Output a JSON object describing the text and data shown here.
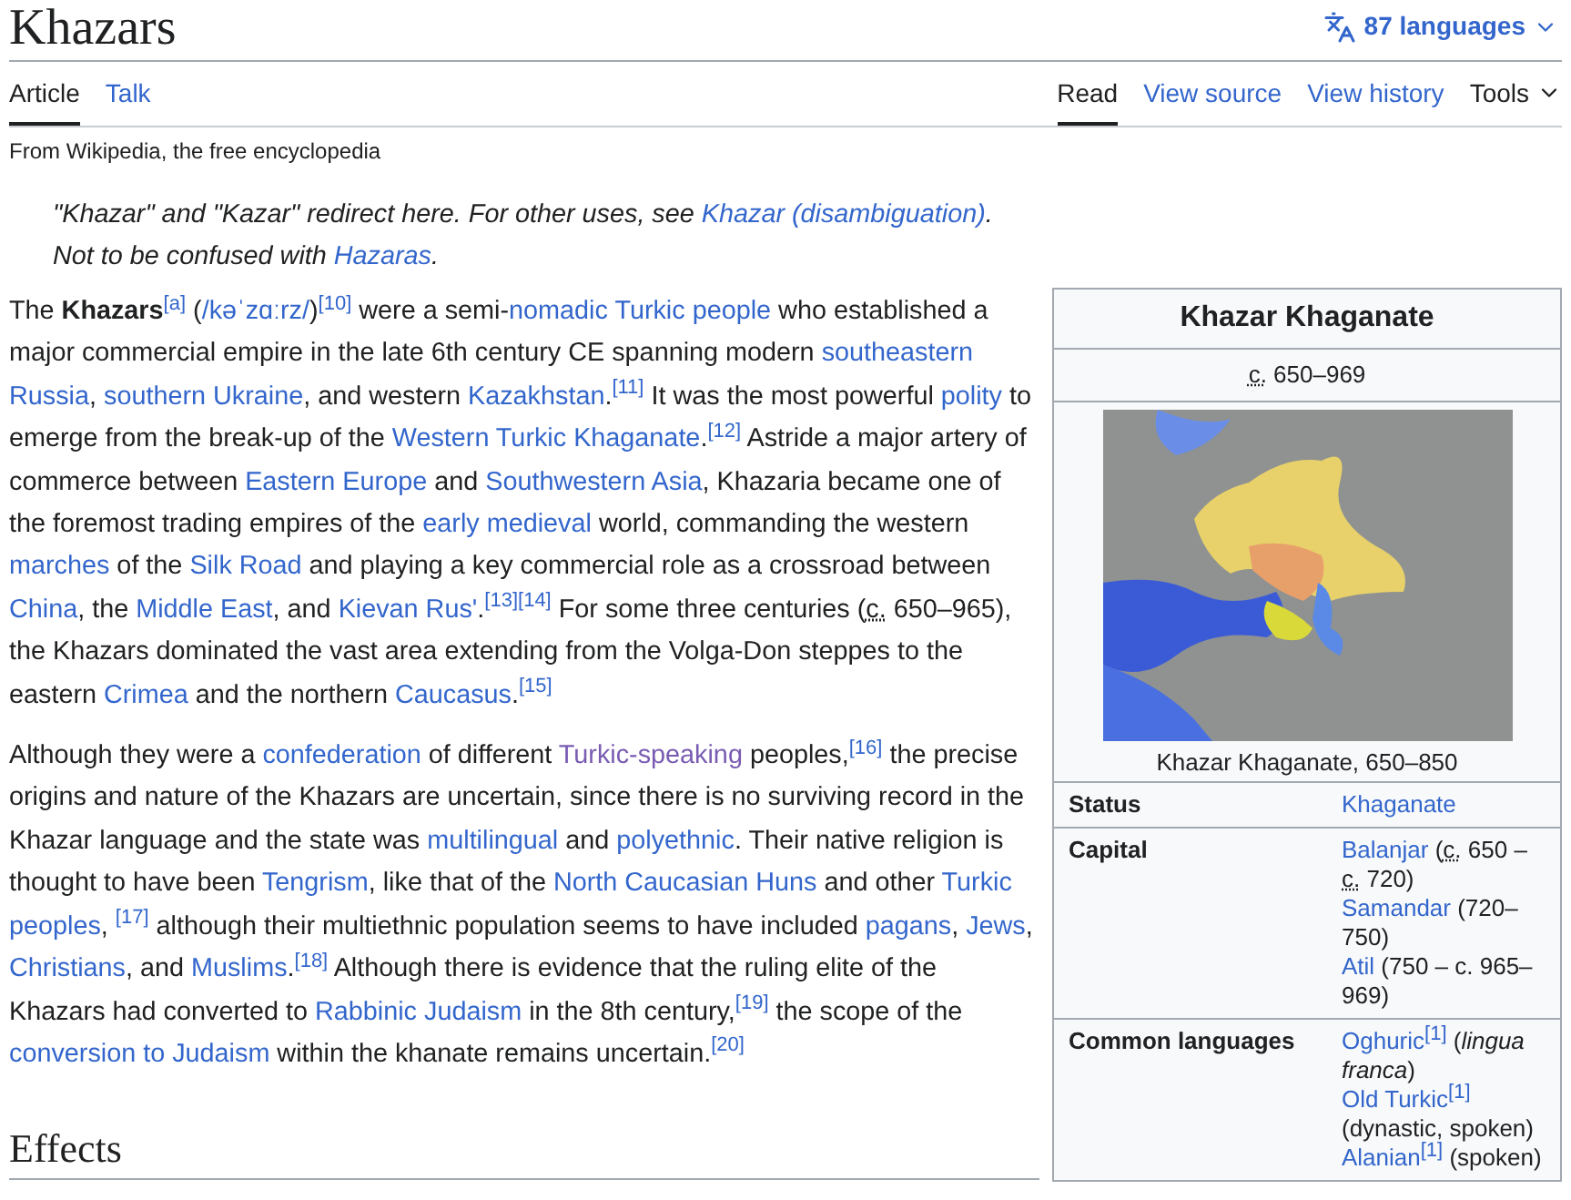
{
  "page": {
    "title": "Khazars",
    "languages": "87 languages"
  },
  "tabs_left": [
    {
      "label": "Article",
      "selected": true
    },
    {
      "label": "Talk",
      "selected": false
    }
  ],
  "tabs_right": [
    {
      "label": "Read",
      "selected": true,
      "kind": "tab"
    },
    {
      "label": "View source",
      "selected": false,
      "kind": "tab"
    },
    {
      "label": "View history",
      "selected": false,
      "kind": "tab"
    },
    {
      "label": "Tools",
      "selected": false,
      "kind": "menu"
    }
  ],
  "tagline": "From Wikipedia, the free encyclopedia",
  "hatnotes": [
    [
      {
        "kind": "text",
        "text": "\"Khazar\" and \"Kazar\" redirect here. For other uses, see "
      },
      {
        "kind": "link",
        "text": "Khazar (disambiguation)"
      },
      {
        "kind": "text",
        "text": "."
      }
    ],
    [
      {
        "kind": "text",
        "text": "Not to be confused with "
      },
      {
        "kind": "link",
        "text": "Hazaras"
      },
      {
        "kind": "text",
        "text": "."
      }
    ]
  ],
  "paragraphs": [
    [
      {
        "kind": "text",
        "text": "The "
      },
      {
        "kind": "bold",
        "text": "Khazars"
      },
      {
        "kind": "ref",
        "text": "[a]"
      },
      {
        "kind": "text",
        "text": " ("
      },
      {
        "kind": "link",
        "text": "/kəˈzɑːrz/"
      },
      {
        "kind": "text",
        "text": ")"
      },
      {
        "kind": "ref",
        "text": "[10]"
      },
      {
        "kind": "text",
        "text": " were a semi-"
      },
      {
        "kind": "link",
        "text": "nomadic"
      },
      {
        "kind": "space"
      },
      {
        "kind": "link",
        "text": "Turkic people"
      },
      {
        "kind": "text",
        "text": " who established a major commercial empire in the late 6th century CE spanning modern "
      },
      {
        "kind": "link",
        "text": "southeastern"
      },
      {
        "kind": "space"
      },
      {
        "kind": "link",
        "text": "Russia"
      },
      {
        "kind": "text",
        "text": ", "
      },
      {
        "kind": "link",
        "text": "southern Ukraine"
      },
      {
        "kind": "text",
        "text": ", and western "
      },
      {
        "kind": "link",
        "text": "Kazakhstan"
      },
      {
        "kind": "text",
        "text": "."
      },
      {
        "kind": "ref",
        "text": "[11]"
      },
      {
        "kind": "text",
        "text": " It was the most powerful "
      },
      {
        "kind": "link",
        "text": "polity"
      },
      {
        "kind": "text",
        "text": " to emerge from the break-up of the "
      },
      {
        "kind": "link",
        "text": "Western Turkic Khaganate"
      },
      {
        "kind": "text",
        "text": "."
      },
      {
        "kind": "ref",
        "text": "[12]"
      },
      {
        "kind": "text",
        "text": " Astride a major artery of commerce between "
      },
      {
        "kind": "link",
        "text": "Eastern Europe"
      },
      {
        "kind": "text",
        "text": " and "
      },
      {
        "kind": "link",
        "text": "Southwestern Asia"
      },
      {
        "kind": "text",
        "text": ", Khazaria became one of the foremost trading empires of the "
      },
      {
        "kind": "link",
        "text": "early medieval"
      },
      {
        "kind": "text",
        "text": " world, commanding the western "
      },
      {
        "kind": "link",
        "text": "marches"
      },
      {
        "kind": "text",
        "text": " of the "
      },
      {
        "kind": "link",
        "text": "Silk Road"
      },
      {
        "kind": "text",
        "text": " and playing a key commercial role as a crossroad between "
      },
      {
        "kind": "link",
        "text": "China"
      },
      {
        "kind": "text",
        "text": ", the "
      },
      {
        "kind": "link",
        "text": "Middle East"
      },
      {
        "kind": "text",
        "text": ", and "
      },
      {
        "kind": "link",
        "text": "Kievan Rus'"
      },
      {
        "kind": "text",
        "text": "."
      },
      {
        "kind": "ref",
        "text": "[13]"
      },
      {
        "kind": "ref",
        "text": "[14]"
      },
      {
        "kind": "text",
        "text": " For some three centuries ("
      },
      {
        "kind": "abbr",
        "text": "c."
      },
      {
        "kind": "text",
        "text": " 650–965), the Khazars dominated the vast area extending from the Volga-Don steppes to the eastern "
      },
      {
        "kind": "link",
        "text": "Crimea"
      },
      {
        "kind": "text",
        "text": " and the northern "
      },
      {
        "kind": "link",
        "text": "Caucasus"
      },
      {
        "kind": "text",
        "text": "."
      },
      {
        "kind": "ref",
        "text": "[15]"
      }
    ],
    [
      {
        "kind": "text",
        "text": "Although they were a "
      },
      {
        "kind": "link",
        "text": "confederation"
      },
      {
        "kind": "text",
        "text": " of different "
      },
      {
        "kind": "visited",
        "text": "Turkic-speaking"
      },
      {
        "kind": "text",
        "text": " peoples,"
      },
      {
        "kind": "ref",
        "text": "[16]"
      },
      {
        "kind": "text",
        "text": " the precise origins and nature of the Khazars are uncertain, since there is no surviving record in the Khazar language and the state was "
      },
      {
        "kind": "link",
        "text": "multilingual"
      },
      {
        "kind": "text",
        "text": " and "
      },
      {
        "kind": "link",
        "text": "polyethnic"
      },
      {
        "kind": "text",
        "text": ". Their native religion is thought to have been "
      },
      {
        "kind": "link",
        "text": "Tengrism"
      },
      {
        "kind": "text",
        "text": ", like that of the "
      },
      {
        "kind": "link",
        "text": "North Caucasian Huns"
      },
      {
        "kind": "text",
        "text": " and other "
      },
      {
        "kind": "link",
        "text": "Turkic"
      },
      {
        "kind": "space"
      },
      {
        "kind": "link",
        "text": "peoples"
      },
      {
        "kind": "text",
        "text": ", "
      },
      {
        "kind": "ref",
        "text": "[17]"
      },
      {
        "kind": "text",
        "text": " although their multiethnic population seems to have included "
      },
      {
        "kind": "link",
        "text": "pagans"
      },
      {
        "kind": "text",
        "text": ", "
      },
      {
        "kind": "link",
        "text": "Jews"
      },
      {
        "kind": "text",
        "text": ", "
      },
      {
        "kind": "link",
        "text": "Christians"
      },
      {
        "kind": "text",
        "text": ", and "
      },
      {
        "kind": "link",
        "text": "Muslims"
      },
      {
        "kind": "text",
        "text": "."
      },
      {
        "kind": "ref",
        "text": "[18]"
      },
      {
        "kind": "text",
        "text": " Although there is evidence that the ruling elite of the Khazars had converted to "
      },
      {
        "kind": "link",
        "text": "Rabbinic Judaism"
      },
      {
        "kind": "text",
        "text": " in the 8th century,"
      },
      {
        "kind": "ref",
        "text": "[19]"
      },
      {
        "kind": "text",
        "text": " the scope of the "
      },
      {
        "kind": "link",
        "text": "conversion to Judaism"
      },
      {
        "kind": "text",
        "text": " within the khanate remains uncertain."
      },
      {
        "kind": "ref",
        "text": "[20]"
      }
    ]
  ],
  "section_heading": "Effects",
  "infobox": {
    "title": "Khazar Khaganate",
    "dates": [
      {
        "kind": "abbr",
        "text": "c."
      },
      {
        "kind": "text",
        "text": " 650–969"
      }
    ],
    "map_caption": "Khazar Khaganate, 650–850",
    "rows": [
      {
        "label": "Status",
        "lines": [
          [
            {
              "kind": "link",
              "text": "Khaganate"
            }
          ]
        ]
      },
      {
        "label": "Capital",
        "lines": [
          [
            {
              "kind": "link",
              "text": "Balanjar"
            },
            {
              "kind": "text",
              "text": " ("
            },
            {
              "kind": "abbr",
              "text": "c."
            },
            {
              "kind": "text",
              "text": " 650 – "
            },
            {
              "kind": "abbr",
              "text": "c."
            },
            {
              "kind": "text",
              "text": " 720)"
            }
          ],
          [
            {
              "kind": "link",
              "text": "Samandar"
            },
            {
              "kind": "text",
              "text": " (720–750)"
            }
          ],
          [
            {
              "kind": "link",
              "text": "Atil"
            },
            {
              "kind": "text",
              "text": " (750 – c. 965–969)"
            }
          ]
        ]
      },
      {
        "label": "Common languages",
        "lines": [
          [
            {
              "kind": "link",
              "text": "Oghuric"
            },
            {
              "kind": "ref",
              "text": "[1]"
            },
            {
              "kind": "text",
              "text": " ("
            },
            {
              "kind": "italic",
              "text": "lingua franca"
            },
            {
              "kind": "text",
              "text": ")"
            }
          ],
          [
            {
              "kind": "link",
              "text": "Old Turkic"
            },
            {
              "kind": "ref",
              "text": "[1]"
            },
            {
              "kind": "text",
              "text": " (dynastic, spoken)"
            }
          ],
          [
            {
              "kind": "link",
              "text": "Alanian"
            },
            {
              "kind": "ref",
              "text": "[1]"
            },
            {
              "kind": "text",
              "text": " (spoken)"
            }
          ]
        ]
      }
    ]
  }
}
